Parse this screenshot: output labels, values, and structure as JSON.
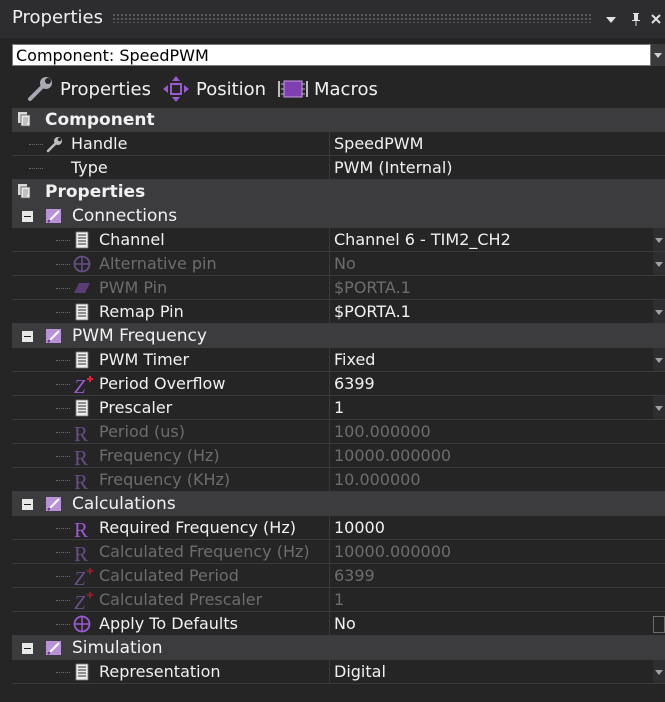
{
  "window": {
    "title": "Properties"
  },
  "component_selector": {
    "value": "Component: SpeedPWM"
  },
  "tabs": [
    {
      "label": "Properties",
      "icon": "wrench-icon"
    },
    {
      "label": "Position",
      "icon": "move-arrows-icon"
    },
    {
      "label": "Macros",
      "icon": "macro-chip-icon"
    }
  ],
  "groups": {
    "component": {
      "title": "Component"
    },
    "properties": {
      "title": "Properties"
    },
    "connections": {
      "title": "Connections"
    },
    "pwm_frequency": {
      "title": "PWM Frequency"
    },
    "calculations": {
      "title": "Calculations"
    },
    "simulation": {
      "title": "Simulation"
    }
  },
  "rows": {
    "handle": {
      "label": "Handle",
      "value": "SpeedPWM"
    },
    "type": {
      "label": "Type",
      "value": "PWM (Internal)"
    },
    "channel": {
      "label": "Channel",
      "value": "Channel 6 - TIM2_CH2"
    },
    "alt_pin": {
      "label": "Alternative pin",
      "value": "No"
    },
    "pwm_pin": {
      "label": "PWM Pin",
      "value": "$PORTA.1"
    },
    "remap_pin": {
      "label": "Remap Pin",
      "value": "$PORTA.1"
    },
    "pwm_timer": {
      "label": "PWM Timer",
      "value": "Fixed"
    },
    "period_overflow": {
      "label": "Period Overflow",
      "value": "6399"
    },
    "prescaler": {
      "label": "Prescaler",
      "value": "1"
    },
    "period_us": {
      "label": "Period (us)",
      "value": "100.000000"
    },
    "freq_hz": {
      "label": "Frequency (Hz)",
      "value": "10000.000000"
    },
    "freq_khz": {
      "label": "Frequency (KHz)",
      "value": "10.000000"
    },
    "req_freq": {
      "label": "Required Frequency (Hz)",
      "value": "10000"
    },
    "calc_freq": {
      "label": "Calculated Frequency (Hz)",
      "value": "10000.000000"
    },
    "calc_period": {
      "label": "Calculated Period",
      "value": "6399"
    },
    "calc_prescaler": {
      "label": "Calculated Prescaler",
      "value": "1"
    },
    "apply_defaults": {
      "label": "Apply To Defaults",
      "value": "No"
    },
    "representation": {
      "label": "Representation",
      "value": "Digital"
    }
  },
  "colors": {
    "background": "#252526",
    "group_header": "#3c3c3f",
    "text": "#f1f1f1",
    "disabled_text": "#6d6d6d",
    "accent_purple": "#9b59d0",
    "accent_red": "#e0203a"
  }
}
